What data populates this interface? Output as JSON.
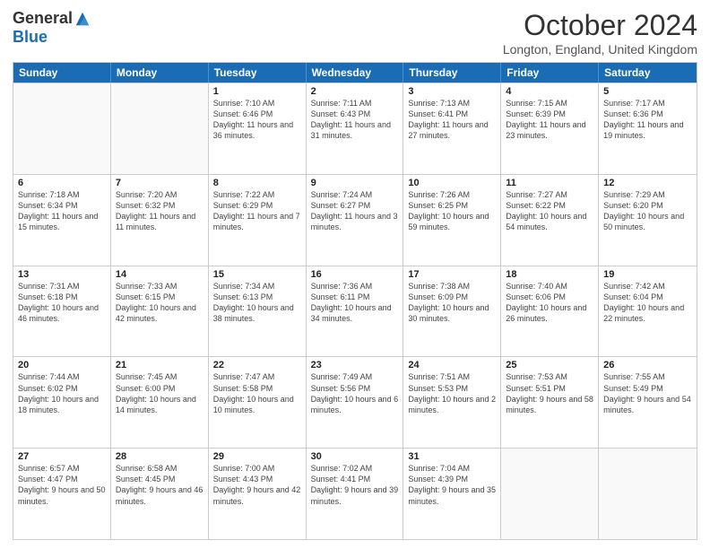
{
  "header": {
    "logo_general": "General",
    "logo_blue": "Blue",
    "month_title": "October 2024",
    "location": "Longton, England, United Kingdom"
  },
  "days_of_week": [
    "Sunday",
    "Monday",
    "Tuesday",
    "Wednesday",
    "Thursday",
    "Friday",
    "Saturday"
  ],
  "weeks": [
    [
      {
        "day": "",
        "sunrise": "",
        "sunset": "",
        "daylight": "",
        "empty": true
      },
      {
        "day": "",
        "sunrise": "",
        "sunset": "",
        "daylight": "",
        "empty": true
      },
      {
        "day": "1",
        "sunrise": "Sunrise: 7:10 AM",
        "sunset": "Sunset: 6:46 PM",
        "daylight": "Daylight: 11 hours and 36 minutes."
      },
      {
        "day": "2",
        "sunrise": "Sunrise: 7:11 AM",
        "sunset": "Sunset: 6:43 PM",
        "daylight": "Daylight: 11 hours and 31 minutes."
      },
      {
        "day": "3",
        "sunrise": "Sunrise: 7:13 AM",
        "sunset": "Sunset: 6:41 PM",
        "daylight": "Daylight: 11 hours and 27 minutes."
      },
      {
        "day": "4",
        "sunrise": "Sunrise: 7:15 AM",
        "sunset": "Sunset: 6:39 PM",
        "daylight": "Daylight: 11 hours and 23 minutes."
      },
      {
        "day": "5",
        "sunrise": "Sunrise: 7:17 AM",
        "sunset": "Sunset: 6:36 PM",
        "daylight": "Daylight: 11 hours and 19 minutes."
      }
    ],
    [
      {
        "day": "6",
        "sunrise": "Sunrise: 7:18 AM",
        "sunset": "Sunset: 6:34 PM",
        "daylight": "Daylight: 11 hours and 15 minutes."
      },
      {
        "day": "7",
        "sunrise": "Sunrise: 7:20 AM",
        "sunset": "Sunset: 6:32 PM",
        "daylight": "Daylight: 11 hours and 11 minutes."
      },
      {
        "day": "8",
        "sunrise": "Sunrise: 7:22 AM",
        "sunset": "Sunset: 6:29 PM",
        "daylight": "Daylight: 11 hours and 7 minutes."
      },
      {
        "day": "9",
        "sunrise": "Sunrise: 7:24 AM",
        "sunset": "Sunset: 6:27 PM",
        "daylight": "Daylight: 11 hours and 3 minutes."
      },
      {
        "day": "10",
        "sunrise": "Sunrise: 7:26 AM",
        "sunset": "Sunset: 6:25 PM",
        "daylight": "Daylight: 10 hours and 59 minutes."
      },
      {
        "day": "11",
        "sunrise": "Sunrise: 7:27 AM",
        "sunset": "Sunset: 6:22 PM",
        "daylight": "Daylight: 10 hours and 54 minutes."
      },
      {
        "day": "12",
        "sunrise": "Sunrise: 7:29 AM",
        "sunset": "Sunset: 6:20 PM",
        "daylight": "Daylight: 10 hours and 50 minutes."
      }
    ],
    [
      {
        "day": "13",
        "sunrise": "Sunrise: 7:31 AM",
        "sunset": "Sunset: 6:18 PM",
        "daylight": "Daylight: 10 hours and 46 minutes."
      },
      {
        "day": "14",
        "sunrise": "Sunrise: 7:33 AM",
        "sunset": "Sunset: 6:15 PM",
        "daylight": "Daylight: 10 hours and 42 minutes."
      },
      {
        "day": "15",
        "sunrise": "Sunrise: 7:34 AM",
        "sunset": "Sunset: 6:13 PM",
        "daylight": "Daylight: 10 hours and 38 minutes."
      },
      {
        "day": "16",
        "sunrise": "Sunrise: 7:36 AM",
        "sunset": "Sunset: 6:11 PM",
        "daylight": "Daylight: 10 hours and 34 minutes."
      },
      {
        "day": "17",
        "sunrise": "Sunrise: 7:38 AM",
        "sunset": "Sunset: 6:09 PM",
        "daylight": "Daylight: 10 hours and 30 minutes."
      },
      {
        "day": "18",
        "sunrise": "Sunrise: 7:40 AM",
        "sunset": "Sunset: 6:06 PM",
        "daylight": "Daylight: 10 hours and 26 minutes."
      },
      {
        "day": "19",
        "sunrise": "Sunrise: 7:42 AM",
        "sunset": "Sunset: 6:04 PM",
        "daylight": "Daylight: 10 hours and 22 minutes."
      }
    ],
    [
      {
        "day": "20",
        "sunrise": "Sunrise: 7:44 AM",
        "sunset": "Sunset: 6:02 PM",
        "daylight": "Daylight: 10 hours and 18 minutes."
      },
      {
        "day": "21",
        "sunrise": "Sunrise: 7:45 AM",
        "sunset": "Sunset: 6:00 PM",
        "daylight": "Daylight: 10 hours and 14 minutes."
      },
      {
        "day": "22",
        "sunrise": "Sunrise: 7:47 AM",
        "sunset": "Sunset: 5:58 PM",
        "daylight": "Daylight: 10 hours and 10 minutes."
      },
      {
        "day": "23",
        "sunrise": "Sunrise: 7:49 AM",
        "sunset": "Sunset: 5:56 PM",
        "daylight": "Daylight: 10 hours and 6 minutes."
      },
      {
        "day": "24",
        "sunrise": "Sunrise: 7:51 AM",
        "sunset": "Sunset: 5:53 PM",
        "daylight": "Daylight: 10 hours and 2 minutes."
      },
      {
        "day": "25",
        "sunrise": "Sunrise: 7:53 AM",
        "sunset": "Sunset: 5:51 PM",
        "daylight": "Daylight: 9 hours and 58 minutes."
      },
      {
        "day": "26",
        "sunrise": "Sunrise: 7:55 AM",
        "sunset": "Sunset: 5:49 PM",
        "daylight": "Daylight: 9 hours and 54 minutes."
      }
    ],
    [
      {
        "day": "27",
        "sunrise": "Sunrise: 6:57 AM",
        "sunset": "Sunset: 4:47 PM",
        "daylight": "Daylight: 9 hours and 50 minutes."
      },
      {
        "day": "28",
        "sunrise": "Sunrise: 6:58 AM",
        "sunset": "Sunset: 4:45 PM",
        "daylight": "Daylight: 9 hours and 46 minutes."
      },
      {
        "day": "29",
        "sunrise": "Sunrise: 7:00 AM",
        "sunset": "Sunset: 4:43 PM",
        "daylight": "Daylight: 9 hours and 42 minutes."
      },
      {
        "day": "30",
        "sunrise": "Sunrise: 7:02 AM",
        "sunset": "Sunset: 4:41 PM",
        "daylight": "Daylight: 9 hours and 39 minutes."
      },
      {
        "day": "31",
        "sunrise": "Sunrise: 7:04 AM",
        "sunset": "Sunset: 4:39 PM",
        "daylight": "Daylight: 9 hours and 35 minutes."
      },
      {
        "day": "",
        "sunrise": "",
        "sunset": "",
        "daylight": "",
        "empty": true
      },
      {
        "day": "",
        "sunrise": "",
        "sunset": "",
        "daylight": "",
        "empty": true
      }
    ]
  ]
}
